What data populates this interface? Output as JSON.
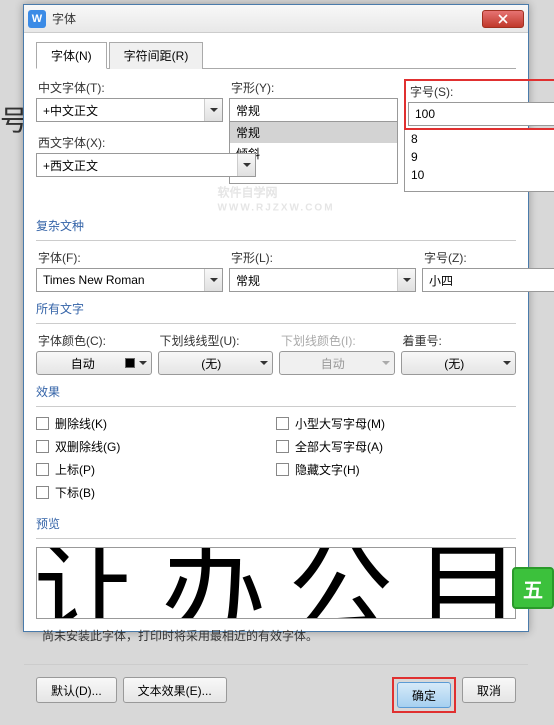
{
  "bg_text": "号\n置",
  "titlebar": {
    "icon": "W",
    "title": "字体"
  },
  "tabs": [
    {
      "label": "字体(N)",
      "active": true
    },
    {
      "label": "字符间距(R)",
      "active": false
    }
  ],
  "chinese_font": {
    "label": "中文字体(T):",
    "value": "+中文正文"
  },
  "style_top": {
    "label": "字形(Y):",
    "value": "常规",
    "options": [
      "常规",
      "倾斜"
    ]
  },
  "size_top": {
    "label": "字号(S):",
    "value": "100",
    "options": [
      "8",
      "9",
      "10"
    ]
  },
  "western_font": {
    "label": "西文字体(X):",
    "value": "+西文正文"
  },
  "complex": {
    "title": "复杂文种",
    "font": {
      "label": "字体(F):",
      "value": "Times New Roman"
    },
    "style": {
      "label": "字形(L):",
      "value": "常规"
    },
    "size": {
      "label": "字号(Z):",
      "value": "小四"
    }
  },
  "all_text": {
    "title": "所有文字",
    "font_color": {
      "label": "字体颜色(C):",
      "value": "自动"
    },
    "underline": {
      "label": "下划线线型(U):",
      "value": "(无)"
    },
    "underline_color": {
      "label": "下划线颜色(I):",
      "value": "自动"
    },
    "emphasis": {
      "label": "着重号:",
      "value": "(无)"
    }
  },
  "effects": {
    "title": "效果",
    "left": [
      {
        "label": "删除线(K)"
      },
      {
        "label": "双删除线(G)"
      },
      {
        "label": "上标(P)"
      },
      {
        "label": "下标(B)"
      }
    ],
    "right": [
      {
        "label": "小型大写字母(M)"
      },
      {
        "label": "全部大写字母(A)"
      },
      {
        "label": "隐藏文字(H)"
      }
    ]
  },
  "preview": {
    "title": "预览",
    "text": "让 办 公 目"
  },
  "note": "尚未安装此字体，打印时将采用最相近的有效字体。",
  "buttons": {
    "default": "默认(D)...",
    "text_effect": "文本效果(E)...",
    "ok": "确定",
    "cancel": "取消"
  },
  "watermark": {
    "main": "软件自学网",
    "sub": "WWW.RJZXW.COM"
  },
  "ime": "五"
}
